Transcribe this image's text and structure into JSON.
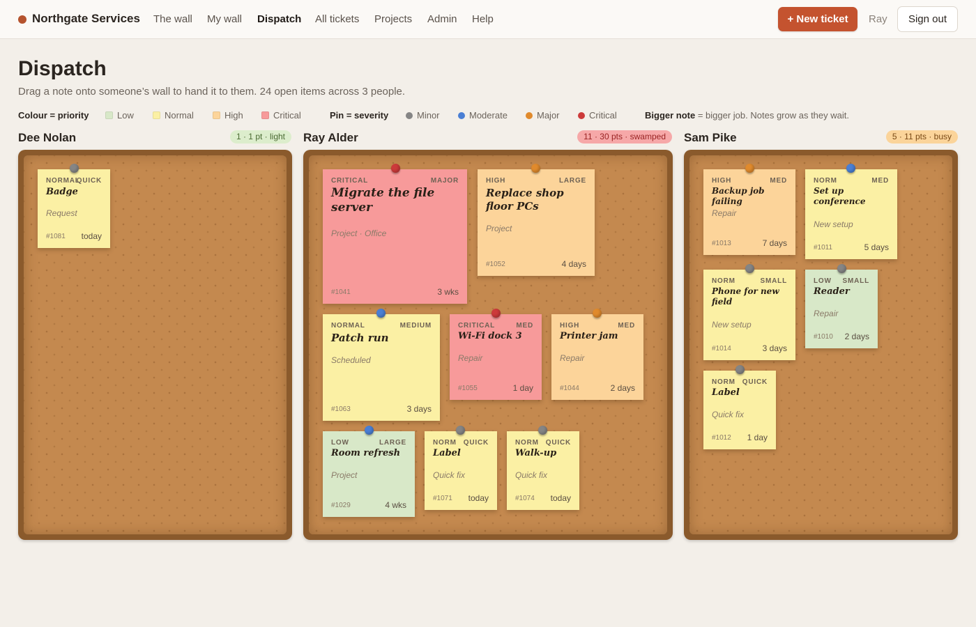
{
  "header": {
    "brand": "Northgate Services",
    "nav": [
      "The wall",
      "My wall",
      "Dispatch",
      "All tickets",
      "Projects",
      "Admin",
      "Help"
    ],
    "new_ticket": "+ New ticket",
    "user": "Ray",
    "sign_out": "Sign out"
  },
  "page": {
    "title": "Dispatch",
    "subtitle": "Drag a note onto someone’s wall to hand it to them. 24 open items across 3 people."
  },
  "legend": {
    "colour_label": "Colour = priority",
    "colours": [
      {
        "label": "Low",
        "color": "#d8e8c8"
      },
      {
        "label": "Normal",
        "color": "#fbf0a4"
      },
      {
        "label": "High",
        "color": "#fcd49a"
      },
      {
        "label": "Critical",
        "color": "#f79a9a"
      }
    ],
    "pin_label": "Pin = severity",
    "pins": [
      {
        "label": "Minor",
        "color": "#858585"
      },
      {
        "label": "Moderate",
        "color": "#4a7fd4"
      },
      {
        "label": "Major",
        "color": "#e08a2c"
      },
      {
        "label": "Critical",
        "color": "#cc3a3a"
      }
    ],
    "bigger_label": "Bigger note",
    "bigger_text": " = bigger job. Notes grow as they wait."
  },
  "columns": [
    {
      "name": "Dee Nolan",
      "badge": "1 · 1 pt · light",
      "notes": [
        {
          "priority": "NORMAL",
          "size": "QUICK",
          "title": "Badge",
          "category": "Request",
          "id": "#1081",
          "age": "today"
        }
      ]
    },
    {
      "name": "Ray Alder",
      "badge": "11 · 30 pts · swamped",
      "notes": [
        {
          "priority": "CRITICAL",
          "size": "MAJOR",
          "title": "Migrate the file server",
          "category": "Project · Office",
          "id": "#1041",
          "age": "3 wks"
        },
        {
          "priority": "HIGH",
          "size": "LARGE",
          "title": "Replace shop floor PCs",
          "category": "Project",
          "id": "#1052",
          "age": "4 days"
        },
        {
          "priority": "NORMAL",
          "size": "MEDIUM",
          "title": "Patch run",
          "category": "Scheduled",
          "id": "#1063",
          "age": "3 days"
        },
        {
          "priority": "CRITICAL",
          "size": "MED",
          "title": "Wi-Fi dock 3",
          "category": "Repair",
          "id": "#1055",
          "age": "1 day"
        },
        {
          "priority": "HIGH",
          "size": "MED",
          "title": "Printer jam",
          "category": "Repair",
          "id": "#1044",
          "age": "2 days"
        },
        {
          "priority": "LOW",
          "size": "LARGE",
          "title": "Room refresh",
          "category": "Project",
          "id": "#1029",
          "age": "4 wks"
        },
        {
          "priority": "NORM",
          "size": "QUICK",
          "title": "Label",
          "category": "Quick fix",
          "id": "#1071",
          "age": "today"
        },
        {
          "priority": "NORM",
          "size": "QUICK",
          "title": "Walk-up",
          "category": "Quick fix",
          "id": "#1074",
          "age": "today"
        }
      ]
    },
    {
      "name": "Sam Pike",
      "badge": "5 · 11 pts · busy",
      "notes": [
        {
          "priority": "HIGH",
          "size": "MED",
          "title": "Backup job failing",
          "category": "Repair",
          "id": "#1013",
          "age": "7 days"
        },
        {
          "priority": "NORM",
          "size": "MED",
          "title": "Set up conference",
          "category": "New setup",
          "id": "#1011",
          "age": "5 days"
        },
        {
          "priority": "NORM",
          "size": "SMALL",
          "title": "Phone for new field",
          "category": "New setup",
          "id": "#1014",
          "age": "3 days"
        },
        {
          "priority": "LOW",
          "size": "SMALL",
          "title": "Reader",
          "category": "Repair",
          "id": "#1010",
          "age": "2 days"
        },
        {
          "priority": "NORM",
          "size": "QUICK",
          "title": "Label",
          "category": "Quick fix",
          "id": "#1012",
          "age": "1 day"
        }
      ]
    }
  ]
}
